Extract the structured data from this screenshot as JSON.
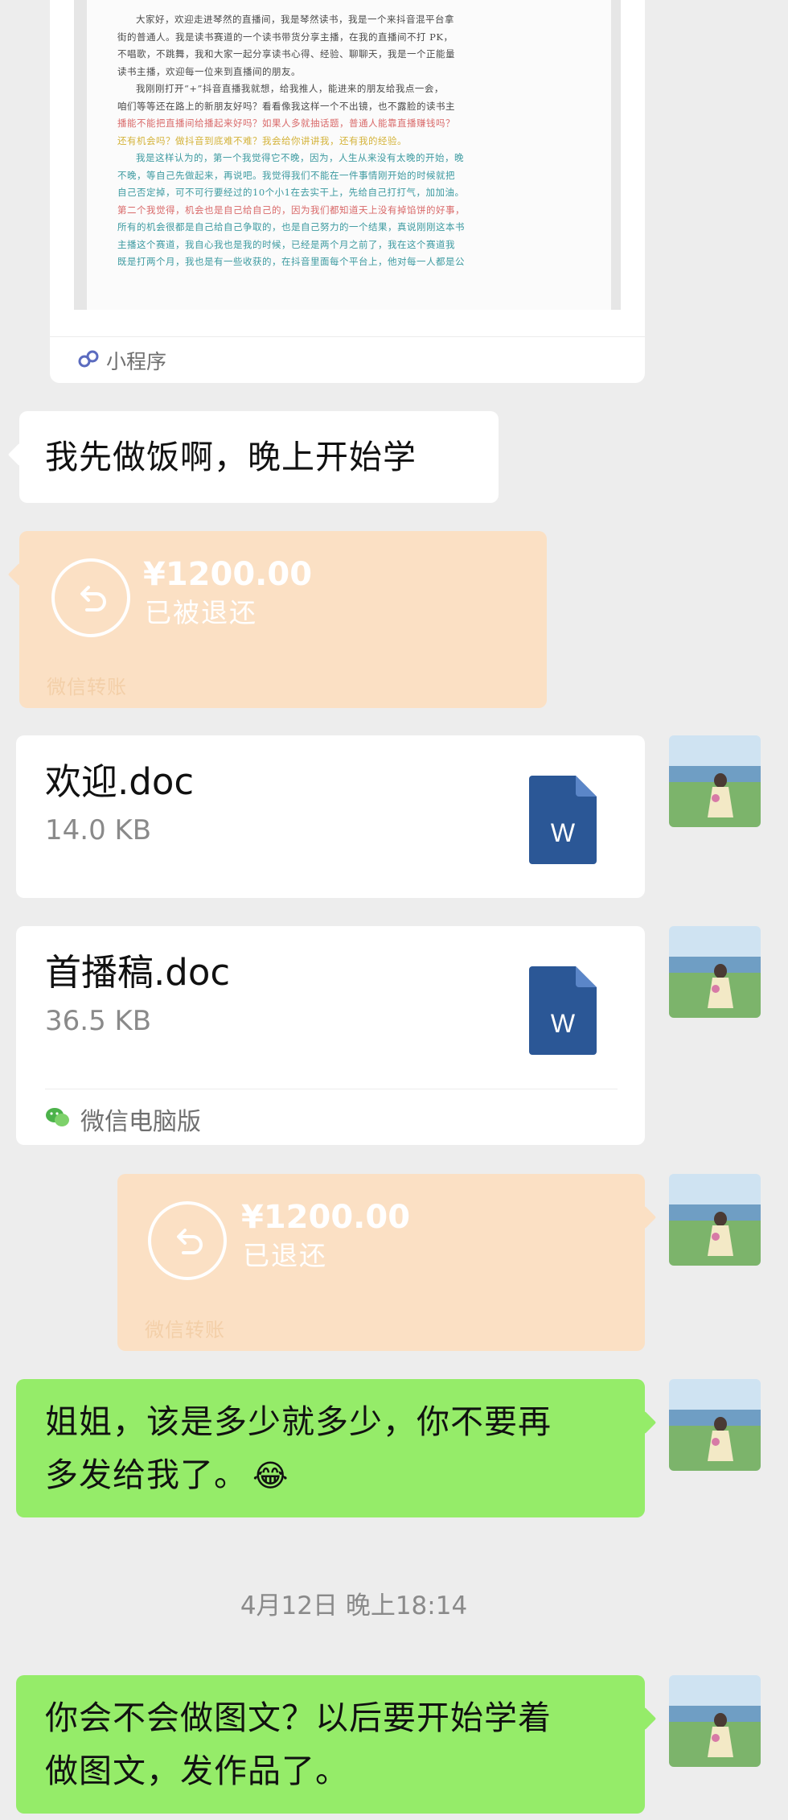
{
  "mini_program": {
    "footer_label": "小程序",
    "doc_lines": [
      {
        "text": "大家好，欢迎走进琴然的直播间，我是琴然读书，我是一个来抖音混平台拿",
        "tone": "normal"
      },
      {
        "text": "街的普通人。我是读书赛道的一个读书带货分享主播，在我的直播间不打 PK，",
        "tone": "normal"
      },
      {
        "text": "不唱歌，不跳舞，我和大家一起分享读书心得、经验、聊聊天，我是一个正能量",
        "tone": "normal"
      },
      {
        "text": "读书主播，欢迎每一位来到直播间的朋友。",
        "tone": "normal"
      },
      {
        "text": "我刚刚打开“+”抖音直播我就想，给我推人，能进来的朋友给我点一会，",
        "tone": "normal"
      },
      {
        "text": "咱们等等还在路上的新朋友好吗？看看像我这样一个不出镜，也不露脸的读书主",
        "tone": "normal"
      },
      {
        "text": "播能不能把直播间给播起来好吗？如果人多就抽话题，普通人能靠直播赚钱吗？",
        "tone": "red"
      },
      {
        "text": "还有机会吗？做抖音到底难不难？我会给你讲讲我，还有我的经验。",
        "tone": "yel"
      },
      {
        "text": "我是这样认为的，第一个我觉得它不晚，因为，人生从来没有太晚的开始，晚",
        "tone": "teal"
      },
      {
        "text": "不晚，等自己先做起来，再说吧。我觉得我们不能在一件事情刚开始的时候就把",
        "tone": "teal"
      },
      {
        "text": "自己否定掉，可不可行要经过的10个小1在去实干上，先给自己打打气，加加油。",
        "tone": "teal"
      },
      {
        "text": "第二个我觉得，机会也是自己给自己的，因为我们都知道天上没有掉馅饼的好事，",
        "tone": "red"
      },
      {
        "text": "所有的机会很都是自己给自己争取的，也是自己努力的一个结果，真说刚刚这本书",
        "tone": "teal"
      },
      {
        "text": "主播这个赛道，我自心我也是我的时候，已经是两个月之前了，我在这个赛道我",
        "tone": "teal"
      },
      {
        "text": "既是打两个月，我也是有一些收获的，在抖音里面每个平台上，他对每一人都是公",
        "tone": "teal"
      }
    ]
  },
  "messages": {
    "m1_text": "我先做饭啊，晚上开始学",
    "transfer1": {
      "amount": "¥1200.00",
      "status": "已被退还",
      "label": "微信转账"
    },
    "file1": {
      "name": "欢迎.doc",
      "size": "14.0 KB",
      "icon_letter": "W"
    },
    "file2": {
      "name": "首播稿.doc",
      "size": "36.5 KB",
      "icon_letter": "W",
      "source": "微信电脑版"
    },
    "transfer2": {
      "amount": "¥1200.00",
      "status": "已退还",
      "label": "微信转账"
    },
    "m2_text_line1": "姐姐，该是多少就多少，你不要再",
    "m2_text_line2": "多发给我了。",
    "m2_emoji": "😂",
    "timestamp": "4月12日 晚上18:14",
    "m3_text_line1": "你会不会做图文？以后要开始学着",
    "m3_text_line2": "做图文，发作品了。"
  },
  "colors": {
    "background": "#ededed",
    "green_bubble": "#95ec69",
    "orange_bubble": "#fbe0c4",
    "word_blue": "#2b5796"
  }
}
